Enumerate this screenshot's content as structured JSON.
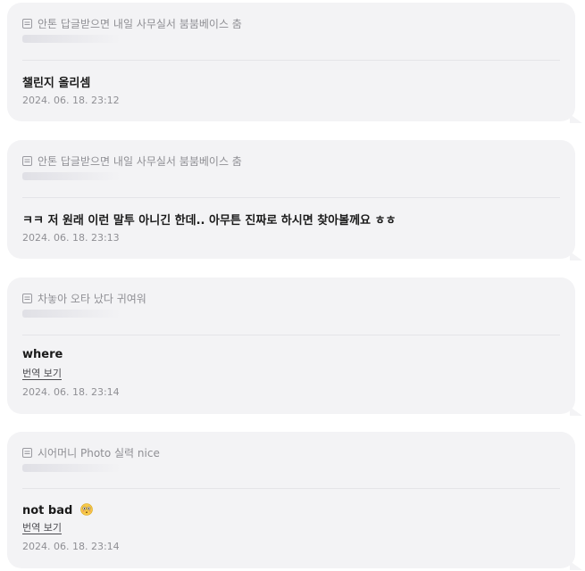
{
  "comments": [
    {
      "quote": "안톤 답글받으면 내일 사무실서 붐붐베이스 춤",
      "message": "챌린지 올리셈",
      "timestamp": "2024. 06. 18. 23:12"
    },
    {
      "quote": "안톤 답글받으면 내일 사무실서 붐붐베이스 춤",
      "message": "ㅋㅋ 저 원래 이런 말투 아니긴 한데.. 아무튼 진짜로 하시면 찾아볼께요 ㅎㅎ",
      "timestamp": "2024. 06. 18. 23:13"
    },
    {
      "quote": "차놓아 오타 났다 귀여워",
      "message": "where",
      "translate": "번역 보기",
      "timestamp": "2024. 06. 18. 23:14"
    },
    {
      "quote": "시어머니 Photo 실력 nice",
      "message": "not bad",
      "emoji": "flushed-face-emoji",
      "translate": "번역 보기",
      "timestamp": "2024. 06. 18. 23:14"
    }
  ],
  "colors": {
    "card_background": "#f3f3f5",
    "muted_text": "#8f8f94",
    "primary_text": "#1a1a1a"
  }
}
